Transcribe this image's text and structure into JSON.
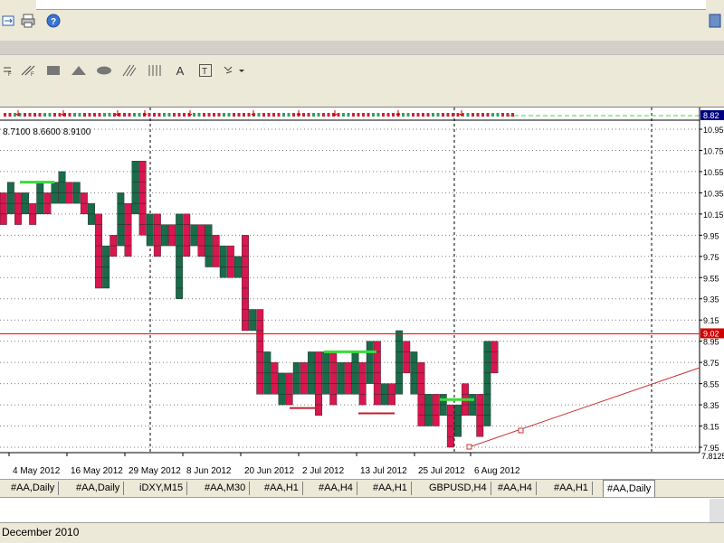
{
  "toolbar": {
    "icons": [
      "fit-window-icon",
      "print-icon",
      "help-icon",
      "hline-icon",
      "trendline-icon",
      "rectangle-icon",
      "triangle-icon",
      "ellipse-icon",
      "channel-icon",
      "fibo-icon",
      "text-icon",
      "label-icon",
      "arrow-tools-icon"
    ],
    "text_tool": "A",
    "label_tool": "T"
  },
  "chart": {
    "ohlc": "8.7100 8.6600 8.9100",
    "bid_label": "8.82",
    "price_line_label": "9.02",
    "bottom_price_label": "7.8125",
    "colors": {
      "up": "#1a6b4a",
      "down": "#d8174f",
      "grid": "#000000",
      "priceLine": "#ff0000",
      "trend": "#cc3333",
      "support": "#3adc3a"
    }
  },
  "chart_data": {
    "type": "point-and-figure",
    "y_tick_labels": [
      "10.95",
      "10.75",
      "10.55",
      "10.35",
      "10.15",
      "9.95",
      "9.75",
      "9.55",
      "9.35",
      "9.15",
      "8.95",
      "8.75",
      "8.55",
      "8.35",
      "8.15",
      "7.95"
    ],
    "y_ticks": [
      10.95,
      10.75,
      10.55,
      10.35,
      10.15,
      9.95,
      9.75,
      9.55,
      9.35,
      9.15,
      8.95,
      8.75,
      8.55,
      8.35,
      8.15,
      7.95
    ],
    "ylim": [
      7.8125,
      11.05
    ],
    "x_tick_labels": [
      "4 May 2012",
      "16 May 2012",
      "29 May 2012",
      "8 Jun 2012",
      "20 Jun 2012",
      "2 Jul 2012",
      "13 Jul 2012",
      "25 Jul 2012",
      "6 Aug 2012"
    ],
    "box_size": 0.1,
    "columns": [
      {
        "dir": "down",
        "high": 10.35,
        "low": 10.05
      },
      {
        "dir": "up",
        "high": 10.45,
        "low": 10.15
      },
      {
        "dir": "down",
        "high": 10.35,
        "low": 10.05
      },
      {
        "dir": "up",
        "high": 10.35,
        "low": 10.15
      },
      {
        "dir": "down",
        "high": 10.25,
        "low": 10.05
      },
      {
        "dir": "up",
        "high": 10.45,
        "low": 10.15
      },
      {
        "dir": "down",
        "high": 10.35,
        "low": 10.15
      },
      {
        "dir": "up",
        "high": 10.45,
        "low": 10.25
      },
      {
        "dir": "up",
        "high": 10.55,
        "low": 10.25
      },
      {
        "dir": "down",
        "high": 10.45,
        "low": 10.25
      },
      {
        "dir": "up",
        "high": 10.45,
        "low": 10.25
      },
      {
        "dir": "down",
        "high": 10.35,
        "low": 10.15
      },
      {
        "dir": "up",
        "high": 10.25,
        "low": 10.05
      },
      {
        "dir": "down",
        "high": 10.15,
        "low": 9.45
      },
      {
        "dir": "up",
        "high": 9.85,
        "low": 9.45
      },
      {
        "dir": "down",
        "high": 9.95,
        "low": 9.75
      },
      {
        "dir": "up",
        "high": 10.35,
        "low": 9.85
      },
      {
        "dir": "down",
        "high": 10.25,
        "low": 9.75
      },
      {
        "dir": "up",
        "high": 10.65,
        "low": 10.15
      },
      {
        "dir": "down",
        "high": 10.65,
        "low": 9.95
      },
      {
        "dir": "up",
        "high": 10.15,
        "low": 9.85
      },
      {
        "dir": "down",
        "high": 10.15,
        "low": 9.75
      },
      {
        "dir": "up",
        "high": 10.05,
        "low": 9.85
      },
      {
        "dir": "down",
        "high": 10.05,
        "low": 9.85
      },
      {
        "dir": "up",
        "high": 10.15,
        "low": 9.35
      },
      {
        "dir": "down",
        "high": 10.15,
        "low": 9.75
      },
      {
        "dir": "up",
        "high": 10.05,
        "low": 9.85
      },
      {
        "dir": "down",
        "high": 10.05,
        "low": 9.75
      },
      {
        "dir": "up",
        "high": 10.05,
        "low": 9.65
      },
      {
        "dir": "down",
        "high": 9.95,
        "low": 9.65
      },
      {
        "dir": "up",
        "high": 9.85,
        "low": 9.55
      },
      {
        "dir": "down",
        "high": 9.85,
        "low": 9.55
      },
      {
        "dir": "up",
        "high": 9.75,
        "low": 9.55
      },
      {
        "dir": "down",
        "high": 9.95,
        "low": 9.05
      },
      {
        "dir": "up",
        "high": 9.25,
        "low": 9.05
      },
      {
        "dir": "down",
        "high": 9.25,
        "low": 8.45
      },
      {
        "dir": "up",
        "high": 8.85,
        "low": 8.45
      },
      {
        "dir": "down",
        "high": 8.75,
        "low": 8.45
      },
      {
        "dir": "up",
        "high": 8.65,
        "low": 8.35
      },
      {
        "dir": "down",
        "high": 8.65,
        "low": 8.35
      },
      {
        "dir": "up",
        "high": 8.75,
        "low": 8.45
      },
      {
        "dir": "down",
        "high": 8.75,
        "low": 8.45
      },
      {
        "dir": "up",
        "high": 8.85,
        "low": 8.45
      },
      {
        "dir": "down",
        "high": 8.85,
        "low": 8.25
      },
      {
        "dir": "up",
        "high": 8.85,
        "low": 8.45
      },
      {
        "dir": "down",
        "high": 8.85,
        "low": 8.35
      },
      {
        "dir": "up",
        "high": 8.75,
        "low": 8.45
      },
      {
        "dir": "down",
        "high": 8.75,
        "low": 8.45
      },
      {
        "dir": "up",
        "high": 8.85,
        "low": 8.45
      },
      {
        "dir": "down",
        "high": 8.75,
        "low": 8.35
      },
      {
        "dir": "up",
        "high": 8.95,
        "low": 8.55
      },
      {
        "dir": "down",
        "high": 8.95,
        "low": 8.35
      },
      {
        "dir": "up",
        "high": 8.55,
        "low": 8.35
      },
      {
        "dir": "down",
        "high": 8.55,
        "low": 8.35
      },
      {
        "dir": "up",
        "high": 9.05,
        "low": 8.45
      },
      {
        "dir": "down",
        "high": 8.95,
        "low": 8.65
      },
      {
        "dir": "up",
        "high": 8.85,
        "low": 8.45
      },
      {
        "dir": "down",
        "high": 8.75,
        "low": 8.15
      },
      {
        "dir": "up",
        "high": 8.45,
        "low": 8.15
      },
      {
        "dir": "down",
        "high": 8.45,
        "low": 8.15
      },
      {
        "dir": "up",
        "high": 8.45,
        "low": 8.25
      },
      {
        "dir": "down",
        "high": 8.35,
        "low": 7.95
      },
      {
        "dir": "up",
        "high": 8.35,
        "low": 8.05
      },
      {
        "dir": "down",
        "high": 8.55,
        "low": 8.25
      },
      {
        "dir": "up",
        "high": 8.45,
        "low": 8.25
      },
      {
        "dir": "down",
        "high": 8.45,
        "low": 8.05
      },
      {
        "dir": "up",
        "high": 8.95,
        "low": 8.15
      },
      {
        "dir": "down",
        "high": 8.95,
        "low": 8.65
      }
    ],
    "horizontal_line": 9.02
  },
  "tabs": [
    "#AA,Daily",
    "#AA,Daily",
    "iDXY,M15",
    "#AA,M30",
    "#AA,H1",
    "#AA,H4",
    "#AA,H1",
    "GBPUSD,H4",
    "#AA,H4",
    "#AA,H1",
    "#AA,Daily"
  ],
  "status": {
    "text": "December 2010"
  }
}
